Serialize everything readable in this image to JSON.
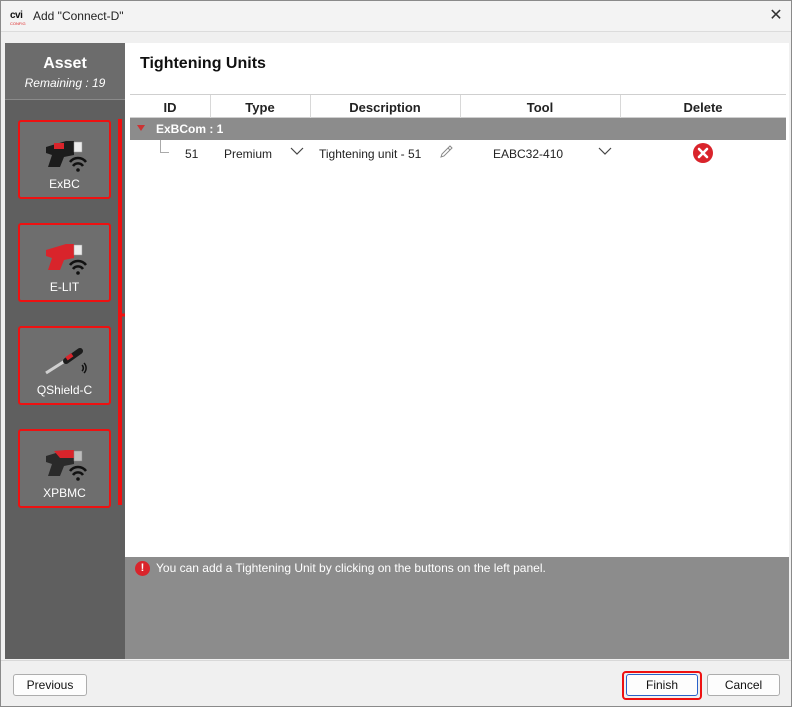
{
  "window": {
    "app_logo_text": "cvi",
    "app_logo_subtext": "CONFIG",
    "title": "Add \"Connect-D\"",
    "close_glyph": "✕"
  },
  "asset_panel": {
    "title": "Asset",
    "remaining": "Remaining : 19",
    "tools": [
      {
        "label": "ExBC",
        "icon": "exbc-tool-icon"
      },
      {
        "label": "E-LIT",
        "icon": "elit-tool-icon"
      },
      {
        "label": "QShield-C",
        "icon": "qshield-wrench-icon"
      },
      {
        "label": "XPBMC",
        "icon": "xpbmc-tool-icon"
      }
    ]
  },
  "main": {
    "title": "Tightening Units",
    "columns": [
      "ID",
      "Type",
      "Description",
      "Tool",
      "Delete"
    ],
    "group": {
      "label": "ExBCom : 1"
    },
    "rows": [
      {
        "id": "51",
        "type": "Premium",
        "description": "Tightening unit - 51",
        "tool": "EABC32-410"
      }
    ],
    "info_message": "You can add a Tightening Unit by clicking on the buttons on the left panel.",
    "info_icon_glyph": "!"
  },
  "footer": {
    "previous_label": "Previous",
    "finish_label": "Finish",
    "cancel_label": "Cancel"
  },
  "colors": {
    "accent_red": "#e11111",
    "panel_gray": "#5f5f5f",
    "group_gray": "#8c8c8c"
  }
}
